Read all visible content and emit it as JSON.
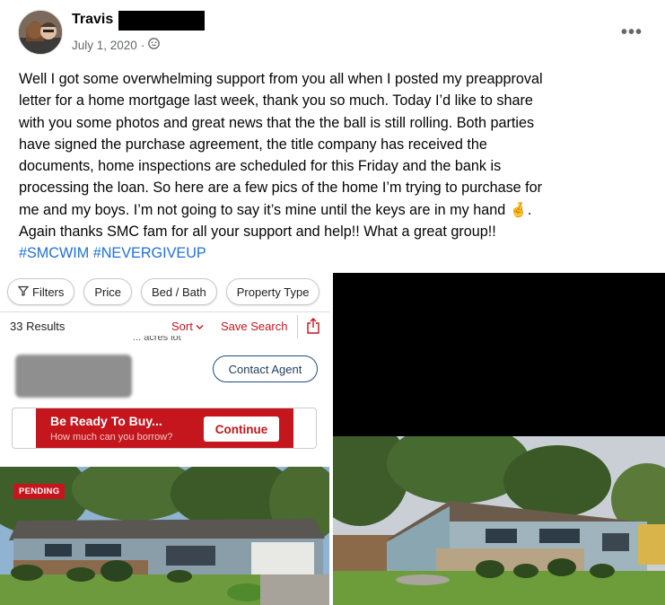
{
  "post": {
    "author": "Travis",
    "date": "July 1, 2020",
    "privacy_icon": "audience-icon",
    "more_label": "•••",
    "text_lines": [
      "Well I got some overwhelming support from you all when I posted my preapproval",
      "letter for a home mortgage last week, thank you so much. Today I’d like to share",
      "with you some photos and great news that the the ball is still rolling. Both parties",
      "have signed the purchase agreement, the title company has received the",
      "documents, home inspections are scheduled for this Friday and the bank is",
      "processing the loan.  So here are a few pics of the home I’m trying to purchase for",
      "me and my boys. I’m not going to say it’s mine until the keys are in my hand 🤞.",
      "Again thanks SMC fam for all your support and help!! What a great group!!"
    ],
    "hashtags": [
      "#SMCWIM",
      "#NEVERGIVEUP"
    ]
  },
  "listing_app": {
    "filters": [
      {
        "label": "Filters",
        "icon": "filter-icon"
      },
      {
        "label": "Price"
      },
      {
        "label": "Bed / Bath"
      },
      {
        "label": "Property Type"
      }
    ],
    "results": "33 Results",
    "sort_label": "Sort",
    "save_search_label": "Save Search",
    "acres_text": "... acres lot",
    "contact_agent_label": "Contact Agent",
    "ad": {
      "title": "Be Ready To Buy...",
      "subtitle": "How much can you borrow?",
      "button": "Continue"
    },
    "badge": "PENDING"
  },
  "colors": {
    "hashtag": "#216fdb",
    "brand_red": "#c4161c",
    "meta_gray": "#65676b"
  }
}
